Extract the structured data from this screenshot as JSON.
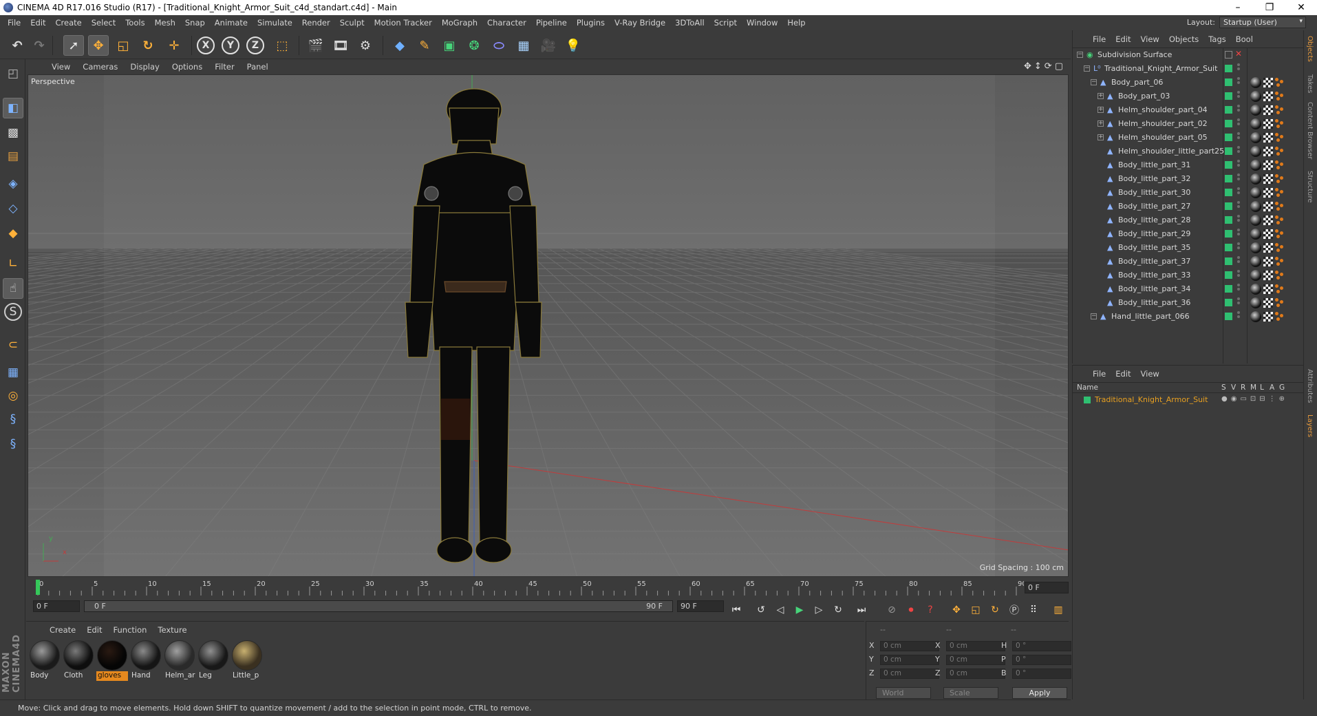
{
  "window": {
    "title": "CINEMA 4D R17.016 Studio (R17) - [Traditional_Knight_Armor_Suit_c4d_standart.c4d] - Main",
    "controls": [
      "–",
      "❐",
      "✕"
    ]
  },
  "menubar": {
    "items": [
      "File",
      "Edit",
      "Create",
      "Select",
      "Tools",
      "Mesh",
      "Snap",
      "Animate",
      "Simulate",
      "Render",
      "Sculpt",
      "Motion Tracker",
      "MoGraph",
      "Character",
      "Pipeline",
      "Plugins",
      "V-Ray Bridge",
      "3DToAll",
      "Script",
      "Window",
      "Help"
    ],
    "layout_label": "Layout:",
    "layout_value": "Startup (User)"
  },
  "toolbar": {
    "axis_x": "X",
    "axis_y": "Y",
    "axis_z": "Z"
  },
  "viewport": {
    "menu": [
      "View",
      "Cameras",
      "Display",
      "Options",
      "Filter",
      "Panel"
    ],
    "label": "Perspective",
    "grid_spacing": "Grid Spacing : 100 cm",
    "axis_y": "y",
    "axis_x": "x"
  },
  "timeline": {
    "ticks": [
      "0",
      "5",
      "10",
      "15",
      "20",
      "25",
      "30",
      "35",
      "40",
      "45",
      "50",
      "55",
      "60",
      "65",
      "70",
      "75",
      "80",
      "85",
      "90"
    ],
    "current_frame_right": "0 F",
    "start_field": "0 F",
    "range_start": "0 F",
    "range_end": "90 F",
    "end_field": "90 F"
  },
  "materials": {
    "menu": [
      "Create",
      "Edit",
      "Function",
      "Texture"
    ],
    "items": [
      {
        "label": "Body",
        "selected": false
      },
      {
        "label": "Cloth",
        "selected": false
      },
      {
        "label": "gloves",
        "selected": true
      },
      {
        "label": "Hand",
        "selected": false
      },
      {
        "label": "Helm_ar",
        "selected": false
      },
      {
        "label": "Leg",
        "selected": false
      },
      {
        "label": "Little_p",
        "selected": false
      }
    ]
  },
  "coordinates": {
    "header_dashes": [
      "--",
      "--",
      "--"
    ],
    "rows": [
      {
        "a": "X",
        "av": "0 cm",
        "b": "X",
        "bv": "0 cm",
        "c": "H",
        "cv": "0 °"
      },
      {
        "a": "Y",
        "av": "0 cm",
        "b": "Y",
        "bv": "0 cm",
        "c": "P",
        "cv": "0 °"
      },
      {
        "a": "Z",
        "av": "0 cm",
        "b": "Z",
        "bv": "0 cm",
        "c": "B",
        "cv": "0 °"
      }
    ],
    "mode_world": "World",
    "mode_scale": "Scale",
    "apply": "Apply"
  },
  "status": "Move: Click and drag to move elements. Hold down SHIFT to quantize movement / add to the selection in point mode, CTRL to remove.",
  "objects": {
    "menu": [
      "File",
      "Edit",
      "View",
      "Objects",
      "Tags",
      "Bool"
    ],
    "items": [
      {
        "name": "Subdivision Surface",
        "level": 0,
        "tags": false
      },
      {
        "name": "Traditional_Knight_Armor_Suit",
        "level": 1,
        "tags": false
      },
      {
        "name": "Body_part_06",
        "level": 2,
        "tags": true
      },
      {
        "name": "Body_part_03",
        "level": 3,
        "tags": true
      },
      {
        "name": "Helm_shoulder_part_04",
        "level": 3,
        "tags": true
      },
      {
        "name": "Helm_shoulder_part_02",
        "level": 3,
        "tags": true
      },
      {
        "name": "Helm_shoulder_part_05",
        "level": 3,
        "tags": true
      },
      {
        "name": "Helm_shoulder_little_part25",
        "level": 3,
        "tags": true
      },
      {
        "name": "Body_little_part_31",
        "level": 3,
        "tags": true
      },
      {
        "name": "Body_little_part_32",
        "level": 3,
        "tags": true
      },
      {
        "name": "Body_little_part_30",
        "level": 3,
        "tags": true
      },
      {
        "name": "Body_little_part_27",
        "level": 3,
        "tags": true
      },
      {
        "name": "Body_little_part_28",
        "level": 3,
        "tags": true
      },
      {
        "name": "Body_little_part_29",
        "level": 3,
        "tags": true
      },
      {
        "name": "Body_little_part_35",
        "level": 3,
        "tags": true
      },
      {
        "name": "Body_little_part_37",
        "level": 3,
        "tags": true
      },
      {
        "name": "Body_little_part_33",
        "level": 3,
        "tags": true
      },
      {
        "name": "Body_little_part_34",
        "level": 3,
        "tags": true
      },
      {
        "name": "Body_little_part_36",
        "level": 3,
        "tags": true
      },
      {
        "name": "Hand_little_part_066",
        "level": 2,
        "tags": true
      }
    ]
  },
  "layers": {
    "menu": [
      "File",
      "Edit",
      "View"
    ],
    "columns": [
      "Name",
      "S",
      "V",
      "R",
      "M",
      "L",
      "A",
      "G"
    ],
    "item": "Traditional_Knight_Armor_Suit",
    "item_color": "#e8a020"
  },
  "right_tabs": [
    "Objects",
    "Takes",
    "Content Browser",
    "Structure",
    "Attributes",
    "Layers"
  ]
}
